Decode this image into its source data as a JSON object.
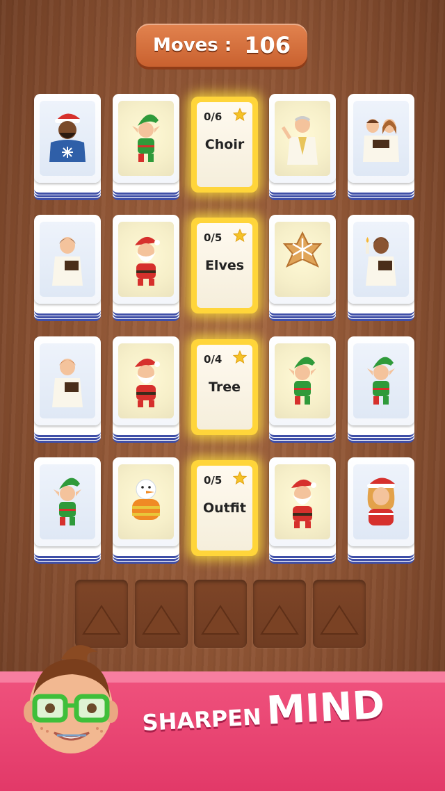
{
  "hud": {
    "moves_label": "Moves :",
    "moves_value": "106"
  },
  "board": {
    "rows": [
      {
        "left": [
          {
            "icon": "caroler-man-santa-hat-icon"
          },
          {
            "icon": "elf-icon"
          }
        ],
        "category": {
          "count": "0/6",
          "name": "Choir"
        },
        "right": [
          {
            "icon": "priest-icon"
          },
          {
            "icon": "choir-duo-icon"
          }
        ]
      },
      {
        "left": [
          {
            "icon": "choir-boy-icon"
          },
          {
            "icon": "santa-with-gift-icon"
          }
        ],
        "category": {
          "count": "0/5",
          "name": "Elves"
        },
        "right": [
          {
            "icon": "gingerbread-snowflake-icon"
          },
          {
            "icon": "choir-girl-candle-icon"
          }
        ]
      },
      {
        "left": [
          {
            "icon": "choir-girl-book-icon"
          },
          {
            "icon": "santa-waving-icon"
          }
        ],
        "category": {
          "count": "0/4",
          "name": "Tree"
        },
        "right": [
          {
            "icon": "elf-with-gift-icon"
          },
          {
            "icon": "elf-cheering-icon"
          }
        ]
      },
      {
        "left": [
          {
            "icon": "elf-candy-cane-icon"
          },
          {
            "icon": "snowman-sweater-icon"
          }
        ],
        "category": {
          "count": "0/5",
          "name": "Outfit"
        },
        "right": [
          {
            "icon": "santa-sack-icon"
          },
          {
            "icon": "girl-santa-hat-icon"
          }
        ]
      }
    ],
    "slot_count": 5
  },
  "banner": {
    "word1": "SHARPEN",
    "word2": "MIND"
  },
  "colors": {
    "accent": "#ffd53a",
    "moves_bg": "#d86f3c",
    "banner": "#e8436f",
    "card_stripe": "#3f4fa8"
  }
}
